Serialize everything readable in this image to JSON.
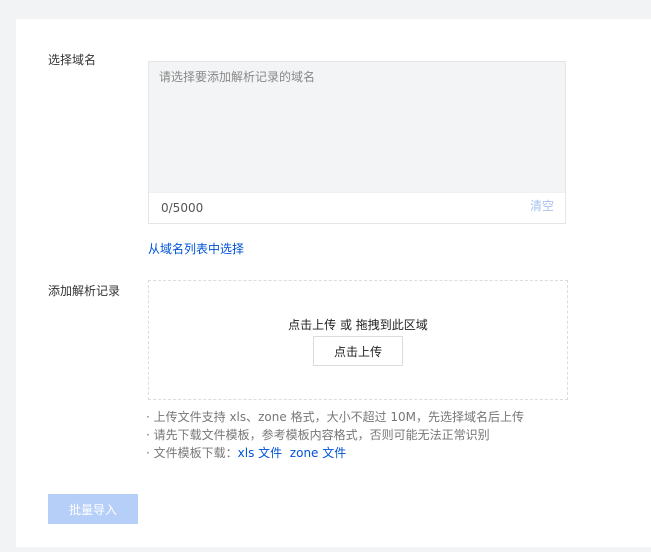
{
  "domain_section": {
    "label": "选择域名",
    "textarea_placeholder": "请选择要添加解析记录的域名",
    "textarea_value": "",
    "counter": "0/5000",
    "clear_label": "清空",
    "pick_from_list": "从域名列表中选择"
  },
  "records_section": {
    "label": "添加解析记录",
    "drop_hint": "点击上传 或 拖拽到此区域",
    "upload_button": "点击上传",
    "notes": [
      "· 上传文件支持 xls、zone 格式，大小不超过 10M，先选择域名后上传",
      "· 请先下载文件模板，参考模板内容格式，否则可能无法正常识别"
    ],
    "template_prefix": "· 文件模板下载：",
    "template_xls": "xls 文件",
    "template_zone": "zone 文件"
  },
  "actions": {
    "import_button": "批量导入"
  }
}
